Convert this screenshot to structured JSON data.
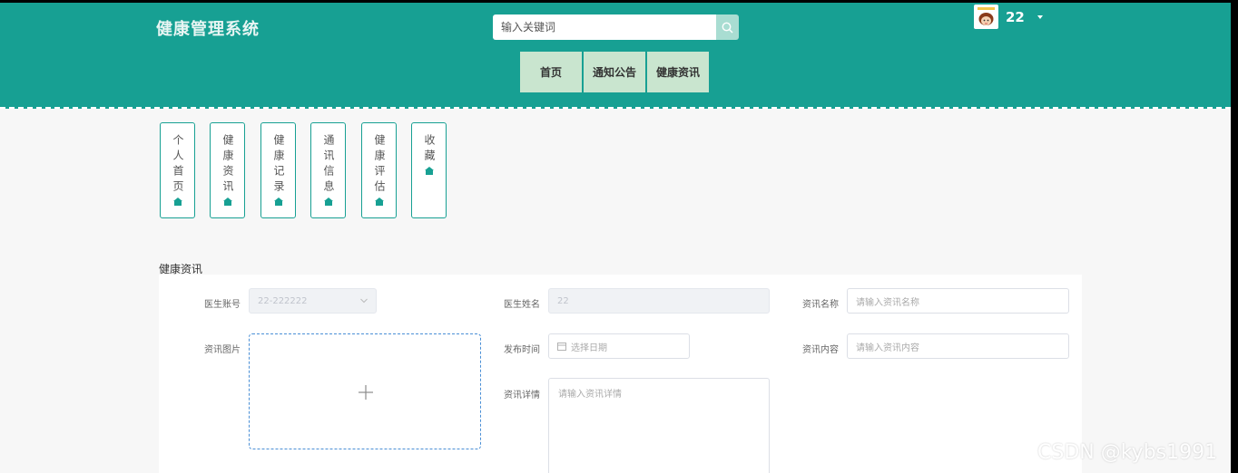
{
  "header": {
    "brand": "健康管理系统",
    "search_placeholder": "输入关键词",
    "username": "22",
    "colors": {
      "bar": "#17a093",
      "nav_item": "#c9e5cf"
    }
  },
  "nav": {
    "items": [
      {
        "label": "首页"
      },
      {
        "label": "通知公告"
      },
      {
        "label": "健康资讯"
      }
    ]
  },
  "sidebar": {
    "items": [
      {
        "label": "个人首页"
      },
      {
        "label": "健康资讯"
      },
      {
        "label": "健康记录"
      },
      {
        "label": "通讯信息"
      },
      {
        "label": "健康评估"
      },
      {
        "label": "收藏"
      }
    ]
  },
  "section": {
    "title": "健康资讯"
  },
  "form": {
    "doctor_account": {
      "label": "医生账号",
      "value": "22-222222"
    },
    "doctor_name": {
      "label": "医生姓名",
      "value": "22"
    },
    "news_name": {
      "label": "资讯名称",
      "placeholder": "请输入资讯名称"
    },
    "news_image": {
      "label": "资讯图片"
    },
    "publish_time": {
      "label": "发布时间",
      "placeholder": "选择日期"
    },
    "news_content": {
      "label": "资讯内容",
      "placeholder": "请输入资讯内容"
    },
    "news_detail": {
      "label": "资讯详情",
      "placeholder": "请输入资讯详情"
    }
  },
  "watermark": "CSDN @kybs1991"
}
